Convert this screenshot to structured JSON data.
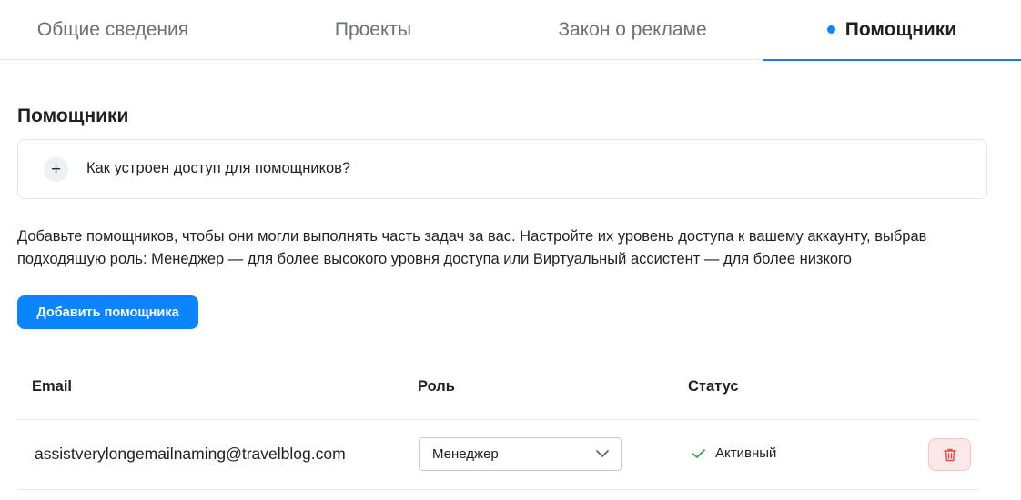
{
  "tabs": [
    {
      "label": "Общие сведения"
    },
    {
      "label": "Проекты"
    },
    {
      "label": "Закон о рекламе"
    },
    {
      "label": "Помощники",
      "active": true
    }
  ],
  "section": {
    "title": "Помощники"
  },
  "accordion": {
    "label": "Как устроен доступ для помощников?",
    "icon": "plus-icon",
    "icon_glyph": "+"
  },
  "description": "Добавьте помощников, чтобы они могли выполнять часть задач за вас. Настройте их уровень доступа к вашему аккаунту, выбрав подходящую роль: Менеджер — для более высокого уровня доступа или Виртуальный ассистент — для более низкого",
  "add_button": {
    "label": "Добавить помощника"
  },
  "table": {
    "headers": [
      "Email",
      "Роль",
      "Статус"
    ],
    "rows": [
      {
        "email": "assistverylongemailnaming@travelblog.com",
        "role": "Менеджер",
        "status": "Активный"
      }
    ]
  },
  "colors": {
    "accent": "#0a84ff",
    "status_ok": "#2fa84f",
    "danger": "#e14b4b",
    "danger_bg": "#fde8e8"
  }
}
